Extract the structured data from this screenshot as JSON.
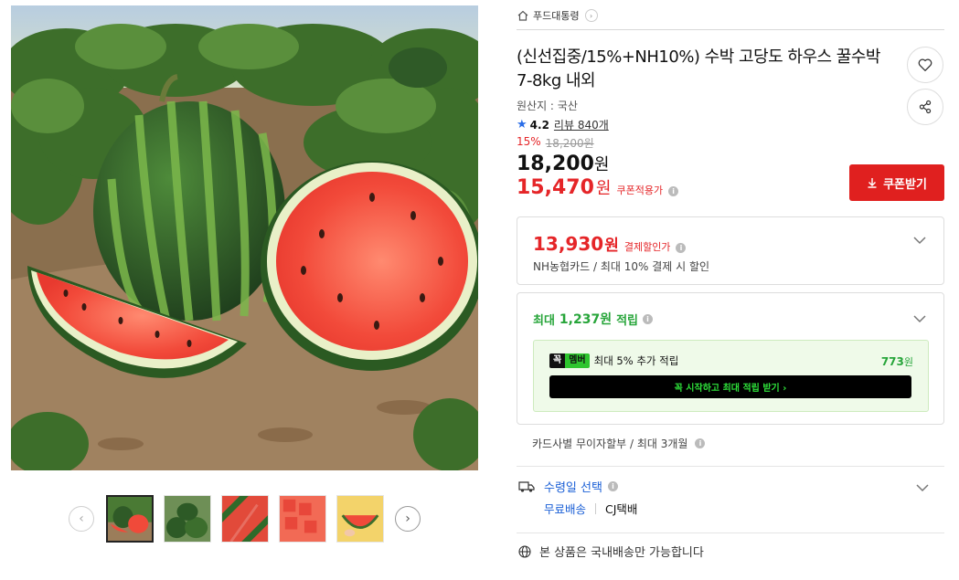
{
  "breadcrumb": {
    "home_icon": "home-icon",
    "store_name": "푸드대통령",
    "chevron": "›"
  },
  "product": {
    "title": "(신선집중/15%+NH10%) 수박 고당도 하우스 꿀수박 7-8kg 내외",
    "origin": "원산지 : 국산",
    "rating": "4.2",
    "review_link": "리뷰 840개",
    "discount_percent": "15%",
    "original_price": "18,200원",
    "price_number": "18,200",
    "price_unit": "원",
    "coupon_price_number": "15,470",
    "coupon_price_unit": "원",
    "coupon_price_label": "쿠폰적용가",
    "coupon_button": "쿠폰받기"
  },
  "card_discount": {
    "price_number": "13,930",
    "price_unit": "원",
    "label": "결제할인가",
    "detail": "NH농협카드 / 최대 10% 결제 시 할인"
  },
  "points": {
    "prefix": "최대",
    "amount": "1,237원",
    "suffix": "적립",
    "member_badge_1": "꼭",
    "member_badge_2": "멤버",
    "member_text": "최대 5% 추가 적립",
    "member_points_number": "773",
    "member_points_unit": "원",
    "member_cta": "꼭 시작하고 최대 적립 받기  ›"
  },
  "installment": {
    "text": "카드사별 무이자할부 / 최대 3개월"
  },
  "delivery": {
    "label": "수령일 선택",
    "free_shipping": "무료배송",
    "carrier": "CJ택배"
  },
  "domestic": {
    "text": "본 상품은 국내배송만 가능합니다"
  },
  "gallery": {
    "thumbnails": [
      "watermalon-field-1",
      "watermelon-pile",
      "watermelon-slices",
      "watermelon-cubes",
      "watermelon-hand"
    ],
    "active_index": 0
  },
  "colors": {
    "accent_red": "#e0201f",
    "points_green": "#27a53a",
    "link_blue": "#1a5fd6"
  }
}
